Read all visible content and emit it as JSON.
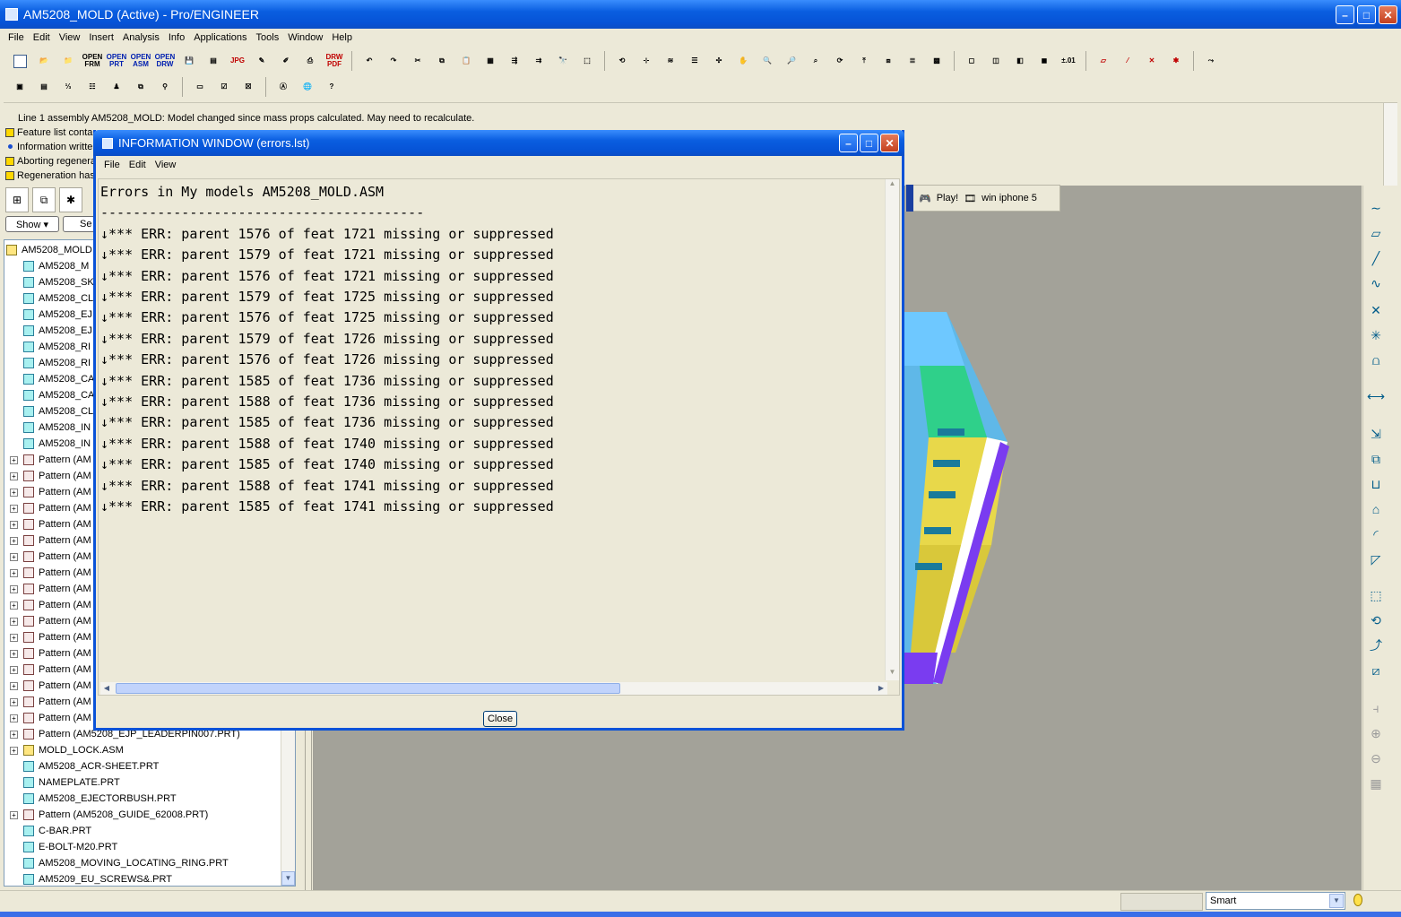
{
  "app": {
    "title": "AM5208_MOLD (Active) - Pro/ENGINEER",
    "menu": [
      "File",
      "Edit",
      "View",
      "Insert",
      "Analysis",
      "Info",
      "Applications",
      "Tools",
      "Window",
      "Help"
    ]
  },
  "toolbar": {
    "open_frm": "OPEN FRM",
    "open_prt": "OPEN PRT",
    "open_asm": "OPEN ASM",
    "open_drw": "OPEN DRW",
    "jpg": "JPG",
    "drw_pdf": "DRW PDF",
    "tolerance": "±.01"
  },
  "messages": [
    {
      "icon": "none",
      "text": "Line 1 assembly AM5208_MOLD: Model changed since mass props calculated. May need to recalculate."
    },
    {
      "icon": "warning",
      "text": "Feature list conta"
    },
    {
      "icon": "info",
      "text": "Information writte"
    },
    {
      "icon": "warning",
      "text": "Aborting regenera"
    },
    {
      "icon": "warning",
      "text": "Regeneration has"
    }
  ],
  "tree": {
    "show_label": "Show ▾",
    "settings_label": "Se",
    "items": [
      {
        "type": "asm",
        "label": "AM5208_MOLD",
        "indent": 0,
        "expander": false
      },
      {
        "type": "prt",
        "label": "AM5208_M",
        "indent": 1,
        "expander": false
      },
      {
        "type": "prt",
        "label": "AM5208_SK",
        "indent": 1,
        "expander": false
      },
      {
        "type": "prt",
        "label": "AM5208_CL",
        "indent": 1,
        "expander": false
      },
      {
        "type": "prt",
        "label": "AM5208_EJ",
        "indent": 1,
        "expander": false
      },
      {
        "type": "prt",
        "label": "AM5208_EJ",
        "indent": 1,
        "expander": false
      },
      {
        "type": "prt",
        "label": "AM5208_RI",
        "indent": 1,
        "expander": false
      },
      {
        "type": "prt",
        "label": "AM5208_RI",
        "indent": 1,
        "expander": false
      },
      {
        "type": "prt",
        "label": "AM5208_CA",
        "indent": 1,
        "expander": false
      },
      {
        "type": "prt",
        "label": "AM5208_CA",
        "indent": 1,
        "expander": false
      },
      {
        "type": "prt",
        "label": "AM5208_CL",
        "indent": 1,
        "expander": false
      },
      {
        "type": "prt",
        "label": "AM5208_IN",
        "indent": 1,
        "expander": false
      },
      {
        "type": "prt",
        "label": "AM5208_IN",
        "indent": 1,
        "expander": false
      },
      {
        "type": "pat",
        "label": "Pattern (AM",
        "indent": 1,
        "expander": true
      },
      {
        "type": "pat",
        "label": "Pattern (AM",
        "indent": 1,
        "expander": true
      },
      {
        "type": "pat",
        "label": "Pattern (AM",
        "indent": 1,
        "expander": true
      },
      {
        "type": "pat",
        "label": "Pattern (AM",
        "indent": 1,
        "expander": true
      },
      {
        "type": "pat",
        "label": "Pattern (AM",
        "indent": 1,
        "expander": true
      },
      {
        "type": "pat",
        "label": "Pattern (AM",
        "indent": 1,
        "expander": true
      },
      {
        "type": "pat",
        "label": "Pattern (AM",
        "indent": 1,
        "expander": true
      },
      {
        "type": "pat",
        "label": "Pattern (AM",
        "indent": 1,
        "expander": true
      },
      {
        "type": "pat",
        "label": "Pattern (AM",
        "indent": 1,
        "expander": true
      },
      {
        "type": "pat",
        "label": "Pattern (AM",
        "indent": 1,
        "expander": true
      },
      {
        "type": "pat",
        "label": "Pattern (AM",
        "indent": 1,
        "expander": true
      },
      {
        "type": "pat",
        "label": "Pattern (AM",
        "indent": 1,
        "expander": true
      },
      {
        "type": "pat",
        "label": "Pattern (AM",
        "indent": 1,
        "expander": true
      },
      {
        "type": "pat",
        "label": "Pattern (AM",
        "indent": 1,
        "expander": true
      },
      {
        "type": "pat",
        "label": "Pattern (AM",
        "indent": 1,
        "expander": true
      },
      {
        "type": "pat",
        "label": "Pattern (AM",
        "indent": 1,
        "expander": true
      },
      {
        "type": "pat",
        "label": "Pattern (AM",
        "indent": 1,
        "expander": true
      },
      {
        "type": "pat",
        "label": "Pattern (AM5208_EJP_LEADERPIN007.PRT)",
        "indent": 1,
        "expander": true
      },
      {
        "type": "asm",
        "label": "MOLD_LOCK.ASM",
        "indent": 1,
        "expander": true
      },
      {
        "type": "prt",
        "label": "AM5208_ACR-SHEET.PRT",
        "indent": 1,
        "expander": false
      },
      {
        "type": "prt",
        "label": "NAMEPLATE.PRT",
        "indent": 1,
        "expander": false
      },
      {
        "type": "prt",
        "label": "AM5208_EJECTORBUSH.PRT",
        "indent": 1,
        "expander": false
      },
      {
        "type": "pat",
        "label": "Pattern (AM5208_GUIDE_62008.PRT)",
        "indent": 1,
        "expander": true
      },
      {
        "type": "prt",
        "label": "C-BAR.PRT",
        "indent": 1,
        "expander": false
      },
      {
        "type": "prt",
        "label": "E-BOLT-M20.PRT",
        "indent": 1,
        "expander": false
      },
      {
        "type": "prt",
        "label": "AM5208_MOVING_LOCATING_RING.PRT",
        "indent": 1,
        "expander": false
      },
      {
        "type": "prt",
        "label": "AM5209_EU_SCREWS&.PRT",
        "indent": 1,
        "expander": false
      }
    ]
  },
  "browser_strip": {
    "play": "Play!",
    "video": "win iphone 5"
  },
  "info_window": {
    "title": "INFORMATION  WINDOW (errors.lst)",
    "menu": [
      "File",
      "Edit",
      "View"
    ],
    "lines": [
      "Errors in My models AM5208_MOLD.ASM",
      "----------------------------------------",
      "↓*** ERR: parent 1576 of feat 1721 missing or suppressed",
      "↓*** ERR: parent 1579 of feat 1721 missing or suppressed",
      "↓*** ERR: parent 1576 of feat 1721 missing or suppressed",
      "↓*** ERR: parent 1579 of feat 1725 missing or suppressed",
      "↓*** ERR: parent 1576 of feat 1725 missing or suppressed",
      "↓*** ERR: parent 1579 of feat 1726 missing or suppressed",
      "↓*** ERR: parent 1576 of feat 1726 missing or suppressed",
      "↓*** ERR: parent 1585 of feat 1736 missing or suppressed",
      "↓*** ERR: parent 1588 of feat 1736 missing or suppressed",
      "↓*** ERR: parent 1585 of feat 1736 missing or suppressed",
      "↓*** ERR: parent 1588 of feat 1740 missing or suppressed",
      "↓*** ERR: parent 1585 of feat 1740 missing or suppressed",
      "↓*** ERR: parent 1588 of feat 1741 missing or suppressed",
      "↓*** ERR: parent 1585 of feat 1741 missing or suppressed"
    ],
    "close_label": "Close"
  },
  "status": {
    "filter_value": "Smart"
  },
  "colors": {
    "titlebar": "#0653d6",
    "graphics_bg": "#a3a299",
    "model_blue": "#38a8f0",
    "model_purple": "#7a3cf0",
    "model_yellow": "#e8d84a"
  }
}
